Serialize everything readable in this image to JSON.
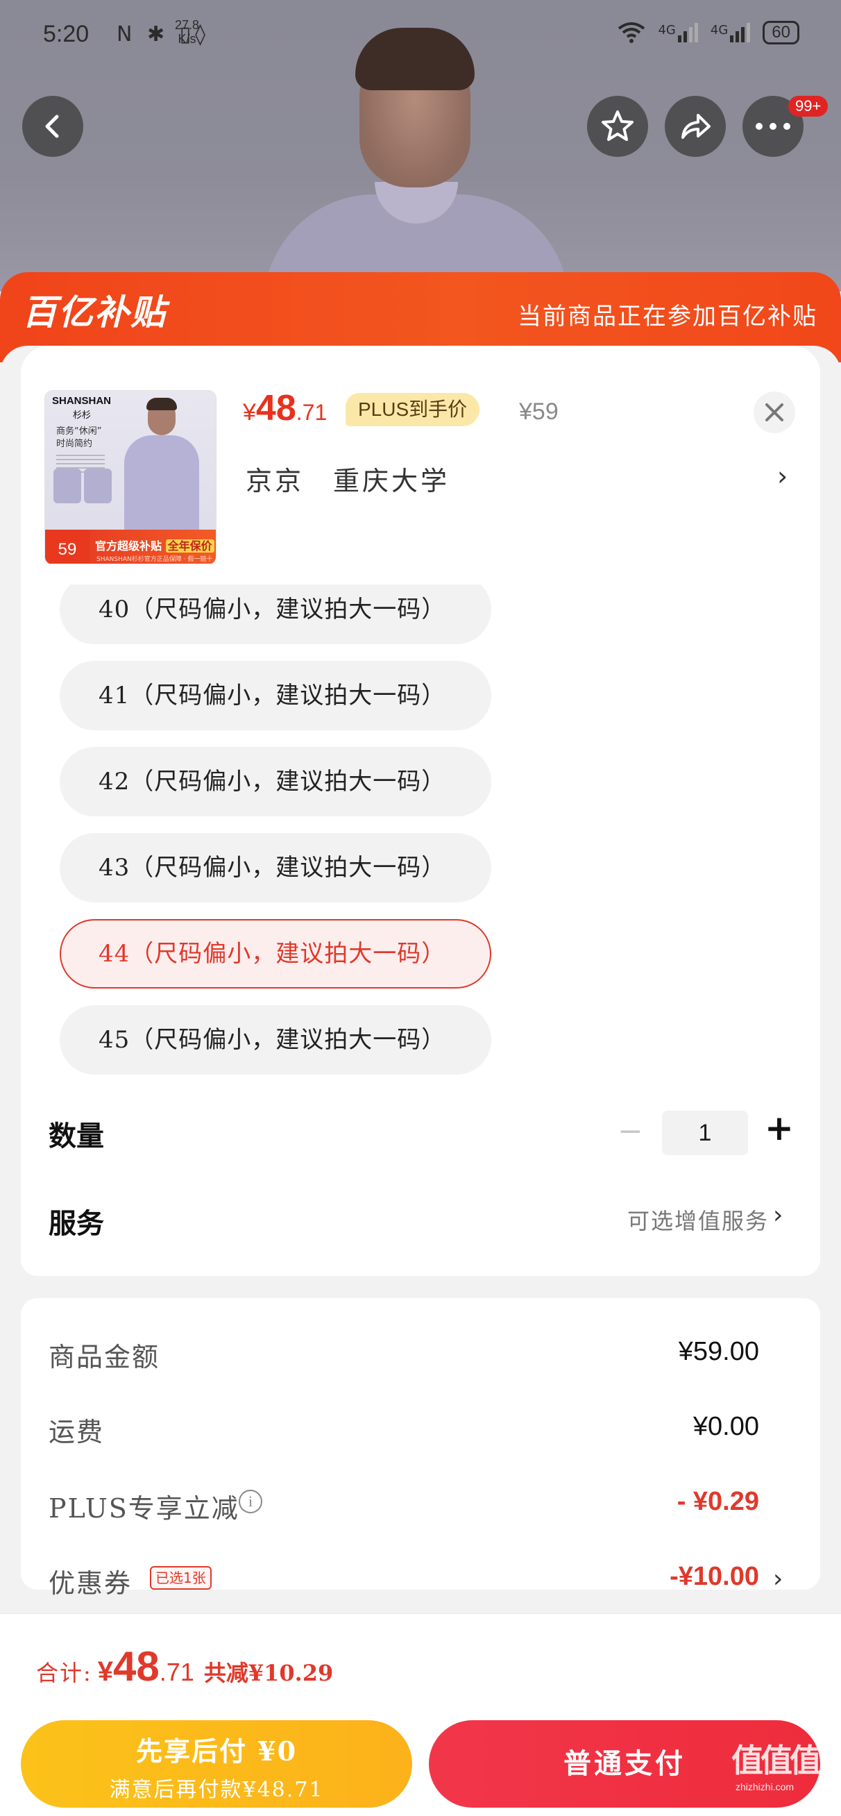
{
  "status_bar": {
    "time": "5:20",
    "icons": "N ✱ ▯◊",
    "speed_value": "27.8",
    "speed_unit": "K/s",
    "signal_1": "4G",
    "signal_2": "4G",
    "battery": "60"
  },
  "top_nav": {
    "notification_badge": "99+"
  },
  "banner": {
    "logo": "百亿补贴",
    "message": "当前商品正在参加百亿补贴"
  },
  "product": {
    "thumb_brand": "SHANSHAN",
    "thumb_brand_cn": "杉杉",
    "thumb_slogan": "商务“休闲” 时尚简约",
    "thumb_price": "59",
    "thumb_banner": "官方超级补贴",
    "thumb_banner_highlight": "全年保价",
    "thumb_banner_fine": "SHANSHAN杉杉官方正品保障 · 假一赔十",
    "price_symbol": "¥",
    "price_int": "48",
    "price_dec": ".71",
    "plus_tag": "PLUS到手价",
    "original_price": "¥59",
    "address": "京京　重庆大学"
  },
  "sizes": [
    {
      "label": "40（尺码偏小，建议拍大一码）",
      "selected": false
    },
    {
      "label": "41（尺码偏小，建议拍大一码）",
      "selected": false
    },
    {
      "label": "42（尺码偏小，建议拍大一码）",
      "selected": false
    },
    {
      "label": "43（尺码偏小，建议拍大一码）",
      "selected": false
    },
    {
      "label": "44（尺码偏小，建议拍大一码）",
      "selected": true
    },
    {
      "label": "45（尺码偏小，建议拍大一码）",
      "selected": false
    }
  ],
  "quantity": {
    "label": "数量",
    "value": "1",
    "minus": "−",
    "plus": "+"
  },
  "service": {
    "label": "服务",
    "hint": "可选增值服务"
  },
  "summary": {
    "goods_label": "商品金额",
    "goods_value": "¥59.00",
    "shipping_label": "运费",
    "shipping_value": "¥0.00",
    "plus_label": "PLUS专享立减",
    "plus_value": "- ¥0.29",
    "coupon_label": "优惠券",
    "coupon_tag": "已选1张",
    "coupon_value": "-¥10.00"
  },
  "footer": {
    "total_label": "合计:",
    "total_symbol": "¥",
    "total_int": "48",
    "total_dec": ".71",
    "total_saving": "共减¥10.29",
    "pay_later_title": "先享后付 ¥0",
    "pay_later_sub": "满意后再付款¥48.71",
    "pay_normal": "普通支付"
  },
  "watermark": {
    "mark": "值值值",
    "site": "zhizhizhi.com"
  },
  "colors": {
    "accent_red": "#e0392b",
    "banner_orange": "#f0441a",
    "pay_later_yellow": "#fbc21a",
    "pay_button_red": "#f2364a"
  }
}
